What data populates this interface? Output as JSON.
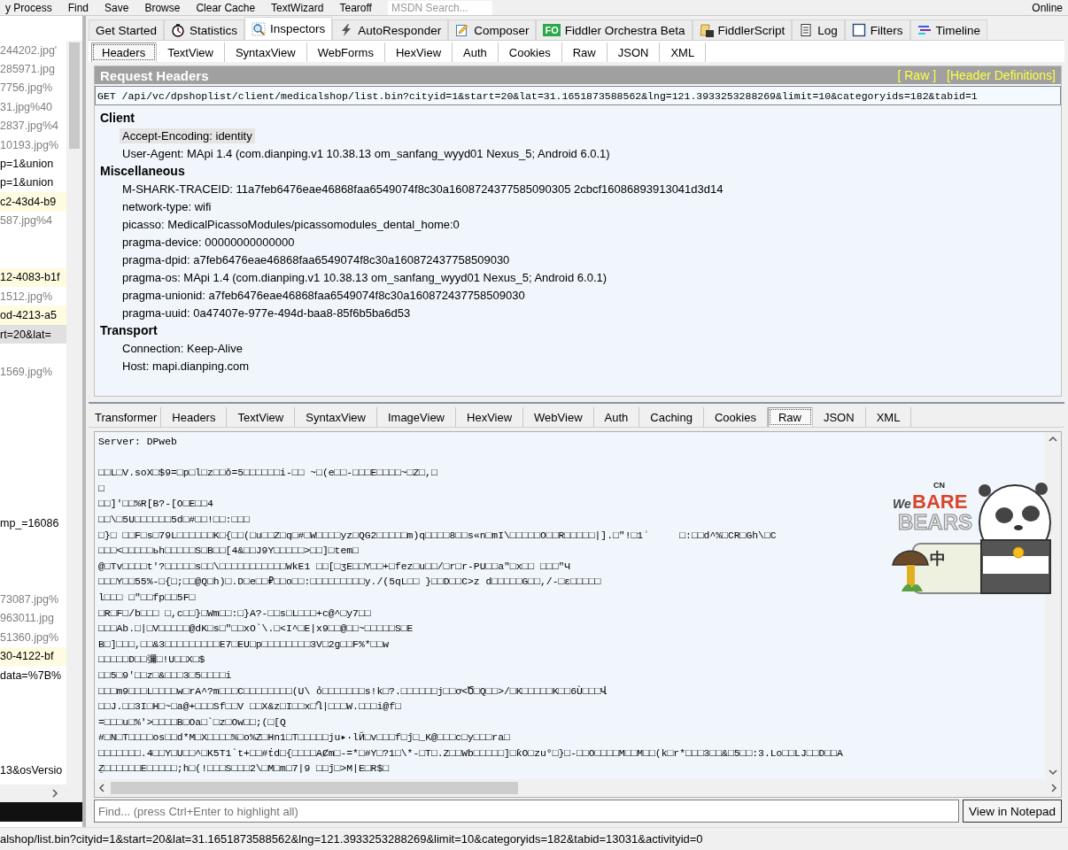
{
  "toolbar": [
    "y Process",
    "Find",
    "Save",
    "Browse",
    "Clear Cache",
    "TextWizard",
    "Tearoff"
  ],
  "toolbar_search": {
    "value": "MSDN Search..."
  },
  "online": "Online",
  "sessions": [
    {
      "kind": "image",
      "text": "244202.jpg'",
      "highlighted": false,
      "selected": false
    },
    {
      "kind": "image",
      "text": "285971.jpg",
      "highlighted": false,
      "selected": false
    },
    {
      "kind": "image",
      "text": "7756.jpg%",
      "highlighted": false,
      "selected": false
    },
    {
      "kind": "image",
      "text": "31.jpg%40",
      "highlighted": false,
      "selected": false
    },
    {
      "kind": "image",
      "text": "2837.jpg%4",
      "highlighted": false,
      "selected": false
    },
    {
      "kind": "image",
      "text": "10193.jpg%",
      "highlighted": false,
      "selected": false
    },
    {
      "kind": "text",
      "text": "p=1&union",
      "highlighted": false,
      "selected": false
    },
    {
      "kind": "text",
      "text": "p=1&union",
      "highlighted": false,
      "selected": false
    },
    {
      "kind": "text",
      "text": "c2-43d4-b9",
      "highlighted": true,
      "selected": false
    },
    {
      "kind": "image",
      "text": "587.jpg%4",
      "highlighted": false,
      "selected": false
    },
    {
      "kind": "blank"
    },
    {
      "kind": "blank"
    },
    {
      "kind": "text",
      "text": "12-4083-b1f",
      "highlighted": true,
      "selected": false
    },
    {
      "kind": "image",
      "text": "1512.jpg%",
      "highlighted": false,
      "selected": false
    },
    {
      "kind": "text",
      "text": "od-4213-a5",
      "highlighted": true,
      "selected": false
    },
    {
      "kind": "text",
      "text": "rt=20&lat=",
      "highlighted": false,
      "selected": true
    },
    {
      "kind": "blank"
    },
    {
      "kind": "image",
      "text": "1569.jpg%",
      "highlighted": false,
      "selected": false
    },
    {
      "kind": "blank"
    },
    {
      "kind": "blank"
    },
    {
      "kind": "blank"
    },
    {
      "kind": "blank"
    },
    {
      "kind": "blank"
    },
    {
      "kind": "blank"
    },
    {
      "kind": "blank"
    },
    {
      "kind": "text",
      "text": "mp_=16086",
      "highlighted": false,
      "selected": false
    },
    {
      "kind": "blank"
    },
    {
      "kind": "blank"
    },
    {
      "kind": "blank"
    },
    {
      "kind": "image",
      "text": "73087.jpg%",
      "highlighted": false,
      "selected": false
    },
    {
      "kind": "image",
      "text": "963011.jpg",
      "highlighted": false,
      "selected": false
    },
    {
      "kind": "image",
      "text": "51360.jpg%",
      "highlighted": false,
      "selected": false
    },
    {
      "kind": "text",
      "text": "30-4122-bf",
      "highlighted": true,
      "selected": false
    },
    {
      "kind": "text",
      "text": "data=%7B%",
      "highlighted": false,
      "selected": false
    },
    {
      "kind": "blank"
    },
    {
      "kind": "blank"
    },
    {
      "kind": "blank"
    },
    {
      "kind": "blank"
    },
    {
      "kind": "text",
      "text": "13&osVersio",
      "highlighted": false,
      "selected": false
    }
  ],
  "main_tabs": [
    {
      "label": "Get Started",
      "selected": false
    },
    {
      "label": "Statistics",
      "selected": false
    },
    {
      "label": "Inspectors",
      "selected": true
    },
    {
      "label": "AutoResponder",
      "selected": false
    },
    {
      "label": "Composer",
      "selected": false
    },
    {
      "label": "Fiddler Orchestra Beta",
      "selected": false
    },
    {
      "label": "FiddlerScript",
      "selected": false
    },
    {
      "label": "Log",
      "selected": false
    },
    {
      "label": "Filters",
      "selected": false
    },
    {
      "label": "Timeline",
      "selected": false
    }
  ],
  "orchestra_badge": "FO",
  "request_tabs": [
    {
      "label": "Headers",
      "selected": true
    },
    {
      "label": "TextView",
      "selected": false
    },
    {
      "label": "SyntaxView",
      "selected": false
    },
    {
      "label": "WebForms",
      "selected": false
    },
    {
      "label": "HexView",
      "selected": false
    },
    {
      "label": "Auth",
      "selected": false
    },
    {
      "label": "Cookies",
      "selected": false
    },
    {
      "label": "Raw",
      "selected": false
    },
    {
      "label": "JSON",
      "selected": false
    },
    {
      "label": "XML",
      "selected": false
    }
  ],
  "request_headers": {
    "title": "Request Headers",
    "links": [
      "[ Raw ]",
      "[Header Definitions]"
    ],
    "request_line": "GET /api/vc/dpshoplist/client/medicalshop/list.bin?cityid=1&start=20&lat=31.1651873588562&lng=121.3933253288269&limit=10&categoryids=182&tabid=1",
    "groups": [
      {
        "name": "Client",
        "headers": [
          {
            "text": "Accept-Encoding: identity",
            "selected": true
          },
          {
            "text": "User-Agent: MApi 1.4 (com.dianping.v1 10.38.13 om_sanfang_wyyd01 Nexus_5; Android 6.0.1)",
            "selected": false
          }
        ]
      },
      {
        "name": "Miscellaneous",
        "headers": [
          {
            "text": "M-SHARK-TRACEID: 11a7feb6476eae46868faa6549074f8c30a1608724377585090305 2cbcf16086893913041d3d14",
            "selected": false
          },
          {
            "text": "network-type: wifi",
            "selected": false
          },
          {
            "text": "picasso: MedicalPicassoModules/picassomodules_dental_home:0",
            "selected": false
          },
          {
            "text": "pragma-device: 00000000000000",
            "selected": false
          },
          {
            "text": "pragma-dpid: a7feb6476eae46868faa6549074f8c30a160872437758509030",
            "selected": false
          },
          {
            "text": "pragma-os: MApi 1.4 (com.dianping.v1 10.38.13 om_sanfang_wyyd01 Nexus_5; Android 6.0.1)",
            "selected": false
          },
          {
            "text": "pragma-unionid: a7feb6476eae46868faa6549074f8c30a160872437758509030",
            "selected": false
          },
          {
            "text": "pragma-uuid: 0a47407e-977e-494d-baa8-85f6b5ba6d53",
            "selected": false
          }
        ]
      },
      {
        "name": "Transport",
        "headers": [
          {
            "text": "Connection: Keep-Alive",
            "selected": false
          },
          {
            "text": "Host: mapi.dianping.com",
            "selected": false
          }
        ]
      }
    ]
  },
  "response_tabs": [
    {
      "label": "Transformer",
      "selected": false
    },
    {
      "label": "Headers",
      "selected": false
    },
    {
      "label": "TextView",
      "selected": false
    },
    {
      "label": "SyntaxView",
      "selected": false
    },
    {
      "label": "ImageView",
      "selected": false
    },
    {
      "label": "HexView",
      "selected": false
    },
    {
      "label": "WebView",
      "selected": false
    },
    {
      "label": "Auth",
      "selected": false
    },
    {
      "label": "Caching",
      "selected": false
    },
    {
      "label": "Cookies",
      "selected": false
    },
    {
      "label": "Raw",
      "selected": true
    },
    {
      "label": "JSON",
      "selected": false
    },
    {
      "label": "XML",
      "selected": false
    }
  ],
  "raw_text": "Server: DPweb\n\n□□L□V.soX□$9=□p□l□z□□ǒ=5□□□□□□i-□□ ~□(e□□-□□□E□□□□~□Z□,□\n□\n□□]'□□%R[B?-[O□E□□4\n□□\\□5U□□□□□□5d□#□□!□□:□□□\n□}□ □□F□s□79L□□□□□□K□{□□(□u□□Z□q□#□W□□□□yz□QG2□□□□□m)q□□□□8□□s«n□mI\\□□□□□O□□R□□□□□|].□\"!□1ʾ     □:□□d^%□CR□Gh\\□C\n□□□<□□□□□ьh□□□□□S□B□□[4&□□J9Y□□□□□>□□]□tem□\n@□Tv□□□□t'?□□□□□s□□\\□□□□□□□□□□□WkE1 □□[□ʒE□□Y□□+□fez□u□□/□r□r-PU□□a\"□x□□ □□□\"Ч\n□□□Y□□55%-□{□;□□@Q□h)□.D□e□□₽□□o□□:□□□□□□□□□y./(5qL□□ }□□D□□C>z d□□□□□G□□,/-□ε□□□□□\nl□□□ □\"□□fp□□5F□\n□R□F□/b□□□ □,c□□}□Wm□□:□}A?-□□s□L□□□+c@^□y7□□\n□□□Ab.□|□V□□□□□@dK□s□\"□□xO`\\.□<I^□E|x9□□@□□~□□□□□S□E\nB□]□□□,□□&3□□□□□□□□□E7□EU□p□□□□□□□□3V□2g□□F%*□□w\n□□□□□D□□彌□!U□□X□$\n□□5□9'□□z□&□□□3□5□□□□i\n□□□m9□□□L□□□□w□rA^?m□□□C□□□□□□□□(U\\ ỏ□□□□□□□s!k□?.□□□□□□j□□ơ<Ծ□Q□□>/□K□□□□□K□□6Ù□□□Վ\n□□J.□□3I□H□~□a@+□□□Sf□□V □□X&z□I□□x□Ղ|□□□W.□□□i@f□\n=□□□u□%'>□□□□B□Oa□`□z□Ow□□;(□[Q\n#□N□T□□□□os□□d*M□X□□□□%□o%Z□Hn1□T□□□□□ju▸·lЙ□v□□□f□ĵ□_K@□□□c□y□□□ra□\n□□□□□□□.4□□Y□U□□^□K5T1`t+□□#ṫd□{□□□□AȻm□-=*□#Y□?1□\\*-□T□.Z□□Wb□□□□□]□ƙO□zu°□}□-□□O□□□□M□□M□□(k□r*□□□3□□&□5□□:3.Lo□□LJ□□D□□A\nẔ□□□□□□E□□□□□;h□(!□□□S□□□2\\□M□m□7|9 □□ĵ□>M|E□R$□",
  "sticker": {
    "badge": "CN",
    "title_small": "We",
    "title_top": "BARE",
    "title_bottom": "BEARS",
    "sign": "中"
  },
  "find": {
    "placeholder": "Find... (press Ctrl+Enter to highlight all)"
  },
  "notepad_button": "View in Notepad",
  "status_bar": "alshop/list.bin?cityid=1&start=20&lat=31.1651873588562&lng=121.3933253288269&limit=10&categoryids=182&tabid=13031&activityid=0"
}
